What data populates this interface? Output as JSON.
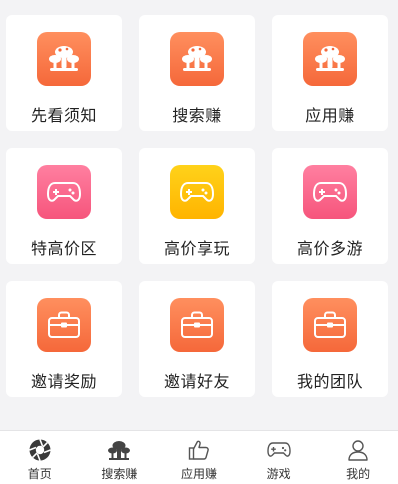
{
  "grid": {
    "items": [
      {
        "label": "先看须知",
        "icon": "mushroom-icon",
        "color": "#f5683a"
      },
      {
        "label": "搜索赚",
        "icon": "mushroom-icon",
        "color": "#f5683a"
      },
      {
        "label": "应用赚",
        "icon": "mushroom-icon",
        "color": "#f5683a"
      },
      {
        "label": "特高价区",
        "icon": "gamepad-icon",
        "color": "#f6557c"
      },
      {
        "label": "高价享玩",
        "icon": "gamepad-icon",
        "color": "#ffb400"
      },
      {
        "label": "高价多游",
        "icon": "gamepad-icon",
        "color": "#f6557c"
      },
      {
        "label": "邀请奖励",
        "icon": "briefcase-icon",
        "color": "#f5683a"
      },
      {
        "label": "邀请好友",
        "icon": "briefcase-icon",
        "color": "#f5683a"
      },
      {
        "label": "我的团队",
        "icon": "briefcase-icon",
        "color": "#f5683a"
      }
    ]
  },
  "tabbar": {
    "tabs": [
      {
        "label": "首页",
        "icon": "aperture-icon",
        "active": true
      },
      {
        "label": "搜索赚",
        "icon": "mushroom-icon",
        "active": false
      },
      {
        "label": "应用赚",
        "icon": "thumbs-up-icon",
        "active": false
      },
      {
        "label": "游戏",
        "icon": "gamepad-icon",
        "active": false
      },
      {
        "label": "我的",
        "icon": "person-icon",
        "active": false
      }
    ]
  }
}
